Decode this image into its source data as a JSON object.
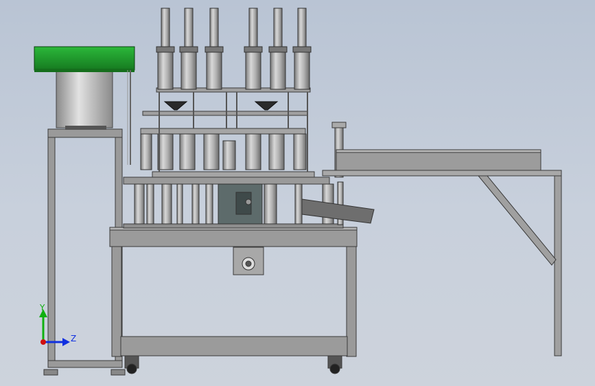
{
  "view": {
    "background_top": "#b9c4d4",
    "background_bottom": "#cdd3dc",
    "model_steel": "#8e8e8e",
    "model_dark": "#6a6a6a",
    "model_edge": "#3a3a3a",
    "hopper_green": "#1f9a2c"
  },
  "triad": {
    "y_label": "Y",
    "z_label": "Z",
    "x_color": "#d01010",
    "y_color": "#10b010",
    "z_color": "#1030e0"
  }
}
